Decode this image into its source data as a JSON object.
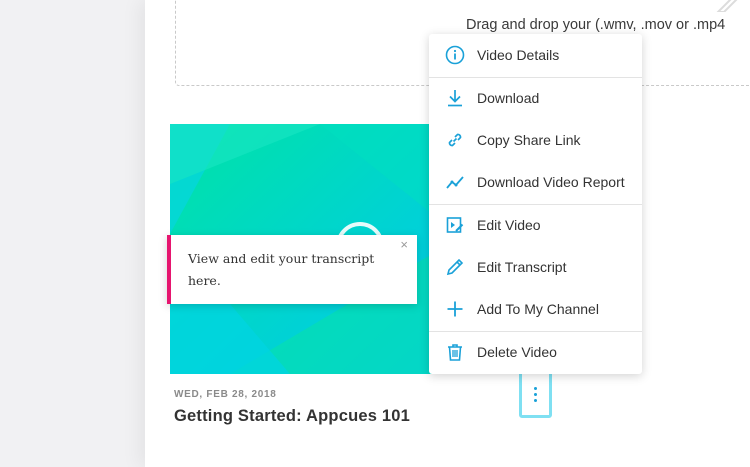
{
  "upload": {
    "dropzone_text": "Drag and drop your (.wmv, .mov or .mp4"
  },
  "video_card": {
    "date": "WED, FEB 28, 2018",
    "title": "Getting Started: Appcues 101"
  },
  "tooltip": {
    "text": "View and edit your transcript here.",
    "close": "×"
  },
  "menu": {
    "items": [
      {
        "label": "Video Details",
        "icon": "info-icon"
      },
      {
        "label": "Download",
        "icon": "download-icon"
      },
      {
        "label": "Copy Share Link",
        "icon": "link-icon"
      },
      {
        "label": "Download Video Report",
        "icon": "chart-line-icon"
      },
      {
        "label": "Edit Video",
        "icon": "edit-video-icon"
      },
      {
        "label": "Edit Transcript",
        "icon": "pencil-icon"
      },
      {
        "label": "Add To My Channel",
        "icon": "plus-icon"
      },
      {
        "label": "Delete Video",
        "icon": "trash-icon"
      }
    ]
  },
  "colors": {
    "accent": "#1aa1d8",
    "hotspot": "#e6156f",
    "thumbnail_start": "#00e0b0",
    "thumbnail_end": "#00c4f0"
  }
}
